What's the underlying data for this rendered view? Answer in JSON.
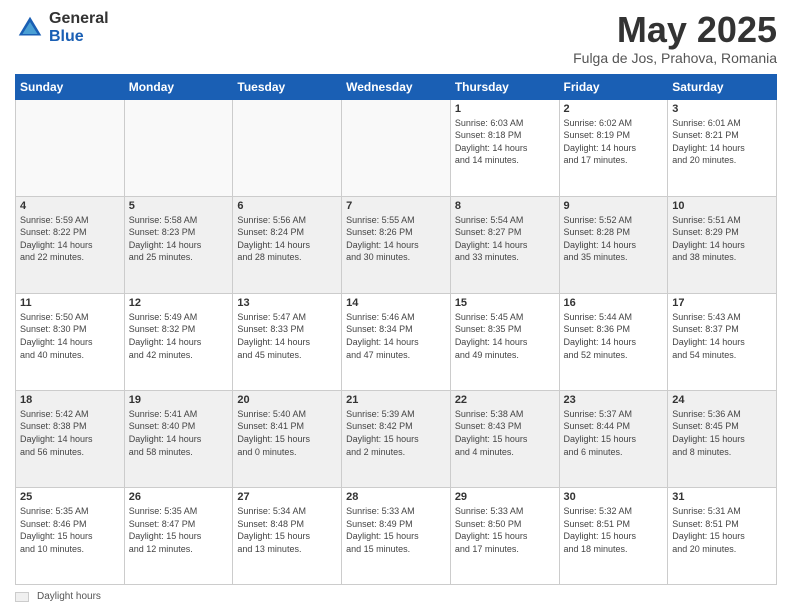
{
  "logo": {
    "general": "General",
    "blue": "Blue"
  },
  "header": {
    "month": "May 2025",
    "location": "Fulga de Jos, Prahova, Romania"
  },
  "days_of_week": [
    "Sunday",
    "Monday",
    "Tuesday",
    "Wednesday",
    "Thursday",
    "Friday",
    "Saturday"
  ],
  "weeks": [
    [
      {
        "num": "",
        "info": "",
        "empty": true
      },
      {
        "num": "",
        "info": "",
        "empty": true
      },
      {
        "num": "",
        "info": "",
        "empty": true
      },
      {
        "num": "",
        "info": "",
        "empty": true
      },
      {
        "num": "1",
        "info": "Sunrise: 6:03 AM\nSunset: 8:18 PM\nDaylight: 14 hours\nand 14 minutes."
      },
      {
        "num": "2",
        "info": "Sunrise: 6:02 AM\nSunset: 8:19 PM\nDaylight: 14 hours\nand 17 minutes."
      },
      {
        "num": "3",
        "info": "Sunrise: 6:01 AM\nSunset: 8:21 PM\nDaylight: 14 hours\nand 20 minutes."
      }
    ],
    [
      {
        "num": "4",
        "info": "Sunrise: 5:59 AM\nSunset: 8:22 PM\nDaylight: 14 hours\nand 22 minutes.",
        "shaded": true
      },
      {
        "num": "5",
        "info": "Sunrise: 5:58 AM\nSunset: 8:23 PM\nDaylight: 14 hours\nand 25 minutes.",
        "shaded": true
      },
      {
        "num": "6",
        "info": "Sunrise: 5:56 AM\nSunset: 8:24 PM\nDaylight: 14 hours\nand 28 minutes.",
        "shaded": true
      },
      {
        "num": "7",
        "info": "Sunrise: 5:55 AM\nSunset: 8:26 PM\nDaylight: 14 hours\nand 30 minutes.",
        "shaded": true
      },
      {
        "num": "8",
        "info": "Sunrise: 5:54 AM\nSunset: 8:27 PM\nDaylight: 14 hours\nand 33 minutes.",
        "shaded": true
      },
      {
        "num": "9",
        "info": "Sunrise: 5:52 AM\nSunset: 8:28 PM\nDaylight: 14 hours\nand 35 minutes.",
        "shaded": true
      },
      {
        "num": "10",
        "info": "Sunrise: 5:51 AM\nSunset: 8:29 PM\nDaylight: 14 hours\nand 38 minutes.",
        "shaded": true
      }
    ],
    [
      {
        "num": "11",
        "info": "Sunrise: 5:50 AM\nSunset: 8:30 PM\nDaylight: 14 hours\nand 40 minutes."
      },
      {
        "num": "12",
        "info": "Sunrise: 5:49 AM\nSunset: 8:32 PM\nDaylight: 14 hours\nand 42 minutes."
      },
      {
        "num": "13",
        "info": "Sunrise: 5:47 AM\nSunset: 8:33 PM\nDaylight: 14 hours\nand 45 minutes."
      },
      {
        "num": "14",
        "info": "Sunrise: 5:46 AM\nSunset: 8:34 PM\nDaylight: 14 hours\nand 47 minutes."
      },
      {
        "num": "15",
        "info": "Sunrise: 5:45 AM\nSunset: 8:35 PM\nDaylight: 14 hours\nand 49 minutes."
      },
      {
        "num": "16",
        "info": "Sunrise: 5:44 AM\nSunset: 8:36 PM\nDaylight: 14 hours\nand 52 minutes."
      },
      {
        "num": "17",
        "info": "Sunrise: 5:43 AM\nSunset: 8:37 PM\nDaylight: 14 hours\nand 54 minutes."
      }
    ],
    [
      {
        "num": "18",
        "info": "Sunrise: 5:42 AM\nSunset: 8:38 PM\nDaylight: 14 hours\nand 56 minutes.",
        "shaded": true
      },
      {
        "num": "19",
        "info": "Sunrise: 5:41 AM\nSunset: 8:40 PM\nDaylight: 14 hours\nand 58 minutes.",
        "shaded": true
      },
      {
        "num": "20",
        "info": "Sunrise: 5:40 AM\nSunset: 8:41 PM\nDaylight: 15 hours\nand 0 minutes.",
        "shaded": true
      },
      {
        "num": "21",
        "info": "Sunrise: 5:39 AM\nSunset: 8:42 PM\nDaylight: 15 hours\nand 2 minutes.",
        "shaded": true
      },
      {
        "num": "22",
        "info": "Sunrise: 5:38 AM\nSunset: 8:43 PM\nDaylight: 15 hours\nand 4 minutes.",
        "shaded": true
      },
      {
        "num": "23",
        "info": "Sunrise: 5:37 AM\nSunset: 8:44 PM\nDaylight: 15 hours\nand 6 minutes.",
        "shaded": true
      },
      {
        "num": "24",
        "info": "Sunrise: 5:36 AM\nSunset: 8:45 PM\nDaylight: 15 hours\nand 8 minutes.",
        "shaded": true
      }
    ],
    [
      {
        "num": "25",
        "info": "Sunrise: 5:35 AM\nSunset: 8:46 PM\nDaylight: 15 hours\nand 10 minutes."
      },
      {
        "num": "26",
        "info": "Sunrise: 5:35 AM\nSunset: 8:47 PM\nDaylight: 15 hours\nand 12 minutes."
      },
      {
        "num": "27",
        "info": "Sunrise: 5:34 AM\nSunset: 8:48 PM\nDaylight: 15 hours\nand 13 minutes."
      },
      {
        "num": "28",
        "info": "Sunrise: 5:33 AM\nSunset: 8:49 PM\nDaylight: 15 hours\nand 15 minutes."
      },
      {
        "num": "29",
        "info": "Sunrise: 5:33 AM\nSunset: 8:50 PM\nDaylight: 15 hours\nand 17 minutes."
      },
      {
        "num": "30",
        "info": "Sunrise: 5:32 AM\nSunset: 8:51 PM\nDaylight: 15 hours\nand 18 minutes."
      },
      {
        "num": "31",
        "info": "Sunrise: 5:31 AM\nSunset: 8:51 PM\nDaylight: 15 hours\nand 20 minutes."
      }
    ]
  ],
  "footer": {
    "legend_label": "Daylight hours"
  }
}
